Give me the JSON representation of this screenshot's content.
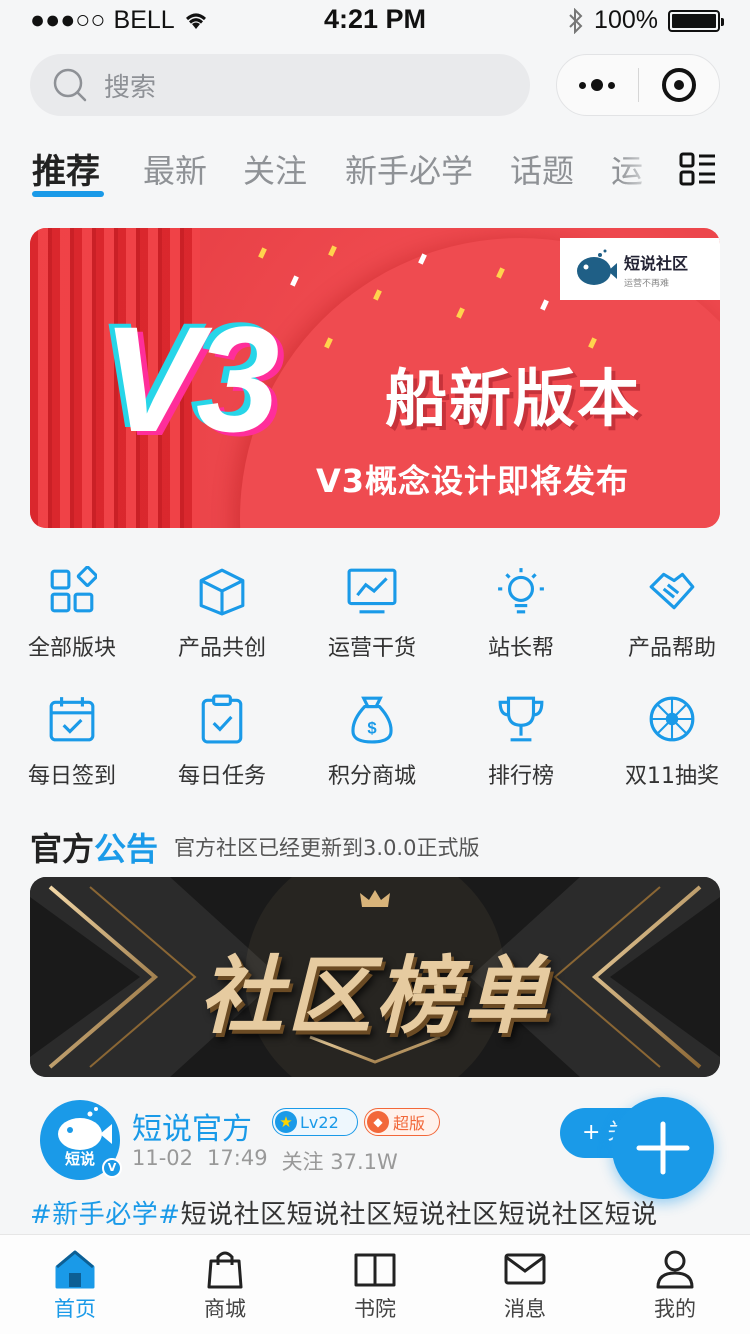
{
  "status_bar": {
    "carrier": "BELL",
    "time": "4:21 PM",
    "battery": "100%"
  },
  "search": {
    "placeholder": "搜索"
  },
  "tabs": [
    {
      "label": "推荐",
      "active": true
    },
    {
      "label": "最新"
    },
    {
      "label": "关注"
    },
    {
      "label": "新手必学"
    },
    {
      "label": "话题"
    },
    {
      "label": "运"
    }
  ],
  "banner": {
    "logo_text": "短说社区",
    "logo_sub": "运营不再难",
    "badge": "V3",
    "title": "船新版本",
    "subtitle": "V3概念设计即将发布"
  },
  "grid": [
    {
      "label": "全部版块",
      "icon": "grid-icon"
    },
    {
      "label": "产品共创",
      "icon": "box-icon"
    },
    {
      "label": "运营干货",
      "icon": "chart-monitor-icon"
    },
    {
      "label": "站长帮",
      "icon": "lightbulb-icon"
    },
    {
      "label": "产品帮助",
      "icon": "handshake-icon"
    },
    {
      "label": "每日签到",
      "icon": "calendar-check-icon"
    },
    {
      "label": "每日任务",
      "icon": "clipboard-check-icon"
    },
    {
      "label": "积分商城",
      "icon": "money-bag-icon"
    },
    {
      "label": "排行榜",
      "icon": "trophy-icon"
    },
    {
      "label": "双11抽奖",
      "icon": "wheel-icon"
    }
  ],
  "announcement": {
    "title_1": "官方",
    "title_2": "公告",
    "text": "官方社区已经更新到3.0.0正式版"
  },
  "rank_banner": {
    "title": "社区榜单"
  },
  "post": {
    "avatar_text": "短说",
    "author": "短说官方",
    "level": "Lv22",
    "vip": "超版",
    "date": "11-02",
    "time": "17:49",
    "followers": "关注 37.1W",
    "follow_button": "+ 关",
    "tag": "#新手必学#",
    "text": "短说社区短说社区短说社区短说社区短说"
  },
  "tabbar": [
    {
      "label": "首页",
      "icon": "home-icon",
      "active": true
    },
    {
      "label": "商城",
      "icon": "shopping-bag-icon"
    },
    {
      "label": "书院",
      "icon": "book-icon"
    },
    {
      "label": "消息",
      "icon": "mail-icon"
    },
    {
      "label": "我的",
      "icon": "user-icon"
    }
  ],
  "colors": {
    "accent": "#1a9ae8",
    "banner_red": "#ef4a4f",
    "vip_orange": "#f2683a"
  }
}
